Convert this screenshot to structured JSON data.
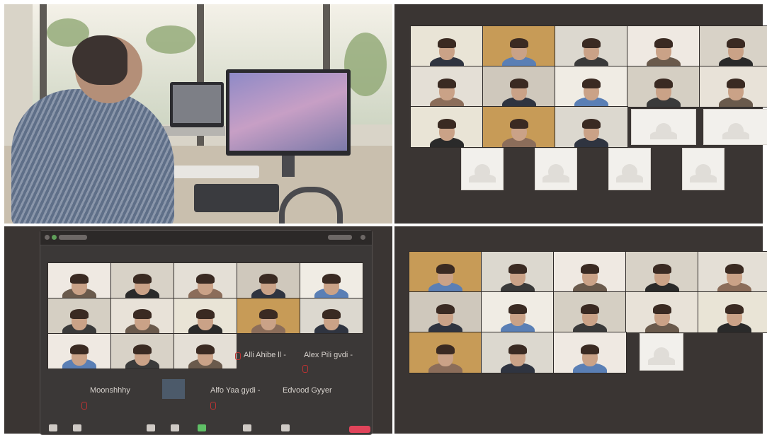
{
  "meeting_window": {
    "title": "",
    "participant_labels": [
      "Alli Ahibe ll -",
      "Alex Pili gvdi -",
      "Alfo Yaa gydi -",
      "Edvood Gyyer"
    ],
    "self_label": "Moonshhhy"
  },
  "colors": {
    "background": "#3a3533",
    "leave_button": "#e0445a",
    "placeholder_tile": "#f2f0ec"
  },
  "icons": {
    "avatar_placeholder": "person-silhouette-icon",
    "mic_muted": "mic-off-icon"
  }
}
